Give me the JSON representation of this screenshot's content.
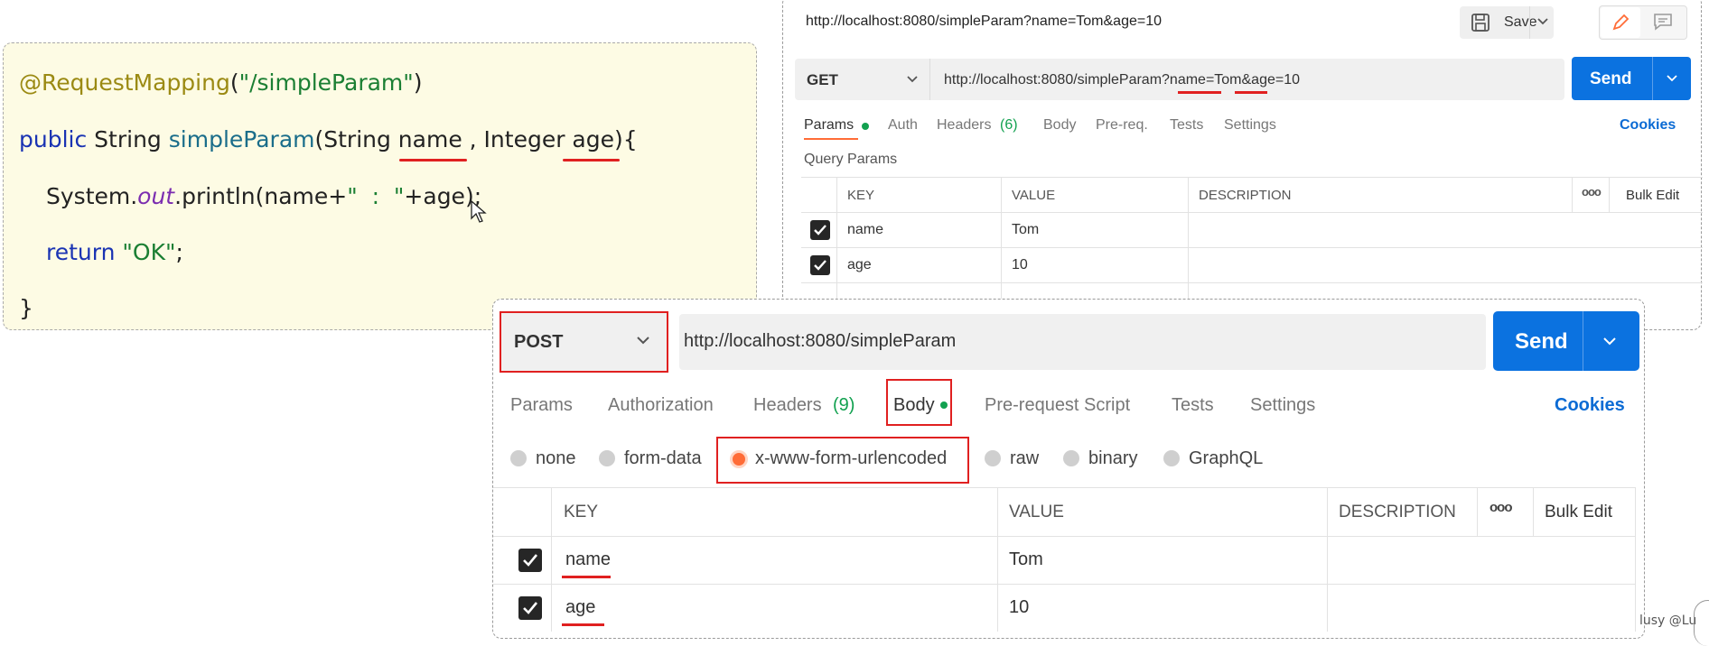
{
  "code": {
    "annotation": "@RequestMapping",
    "paren_open": "(",
    "mapping_string": "\"/simpleParam\"",
    "paren_close": ")",
    "kw_public": "public",
    "type_string": " String ",
    "method_name": "simpleParam",
    "params": "(String name , Integer age){",
    "sys": "System.",
    "out": "out",
    "println": ".println(name+",
    "sep_string": "\"  :  \"",
    "println_end": "+age);",
    "kw_return": "return",
    "ok_string": " \"OK\"",
    "semicolon": ";",
    "close_brace": "}"
  },
  "top_panel": {
    "title_url": "http://localhost:8080/simpleParam?name=Tom&age=10",
    "save_label": "Save",
    "method": "GET",
    "url": "http://localhost:8080/simpleParam?name=Tom&age=10",
    "send_label": "Send",
    "tabs": [
      {
        "label": "Params"
      },
      {
        "label": "Auth"
      },
      {
        "label": "Headers"
      },
      {
        "label": "(6)"
      },
      {
        "label": "Body"
      },
      {
        "label": "Pre-req."
      },
      {
        "label": "Tests"
      },
      {
        "label": "Settings"
      }
    ],
    "cookies_label": "Cookies",
    "section_label": "Query Params",
    "columns": {
      "key": "KEY",
      "value": "VALUE",
      "description": "DESCRIPTION",
      "more": "ooo",
      "bulk_edit": "Bulk Edit"
    },
    "rows": [
      {
        "key": "name",
        "value": "Tom"
      },
      {
        "key": "age",
        "value": "10"
      }
    ]
  },
  "bottom_panel": {
    "method": "POST",
    "url": "http://localhost:8080/simpleParam",
    "send_label": "Send",
    "tabs": [
      {
        "label": "Params"
      },
      {
        "label": "Authorization"
      },
      {
        "label": "Headers"
      },
      {
        "label": "(9)"
      },
      {
        "label": "Body"
      },
      {
        "label": "Pre-request Script"
      },
      {
        "label": "Tests"
      },
      {
        "label": "Settings"
      }
    ],
    "cookies_label": "Cookies",
    "body_types": [
      {
        "label": "none"
      },
      {
        "label": "form-data"
      },
      {
        "label": "x-www-form-urlencoded"
      },
      {
        "label": "raw"
      },
      {
        "label": "binary"
      },
      {
        "label": "GraphQL"
      }
    ],
    "columns": {
      "key": "KEY",
      "value": "VALUE",
      "description": "DESCRIPTION",
      "more": "ooo",
      "bulk_edit": "Bulk Edit"
    },
    "rows": [
      {
        "key": "name",
        "value": "Tom"
      },
      {
        "key": "age",
        "value": "10"
      }
    ]
  },
  "watermark": "lusy @Lu",
  "colors": {
    "send": "#0b72e0",
    "highlight": "#e02020",
    "active_tab": "#ff6c37",
    "dot": "#12a150",
    "code_bg": "#fdfbe4"
  }
}
